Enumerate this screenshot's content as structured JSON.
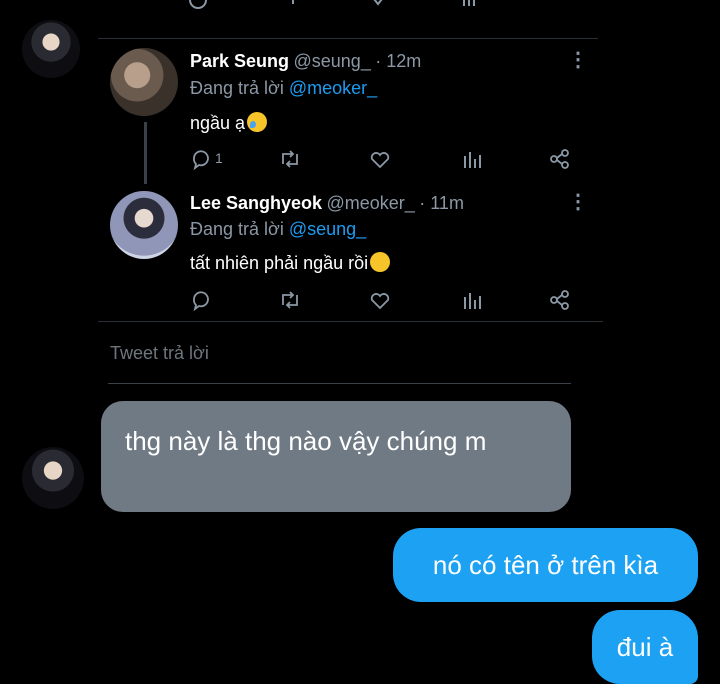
{
  "quoted_thread": {
    "tweets": [
      {
        "display_name": "Park Seung",
        "handle": "@seung_",
        "time": "· 12m",
        "reply_prefix": "Đang trả lời ",
        "reply_to": "@meoker_",
        "text": "ngầu ạ",
        "emoji": "weary-sweat-emoji",
        "reply_count": "1"
      },
      {
        "display_name": "Lee Sanghyeok",
        "handle": "@meoker_",
        "time": "· 11m",
        "reply_prefix": "Đang trả lời ",
        "reply_to": "@seung_",
        "text": "tất nhiên phải ngầu rồi",
        "emoji": "smirk-emoji"
      }
    ],
    "reply_placeholder": "Tweet trả lời"
  },
  "messages": [
    {
      "direction": "incoming",
      "text": "thg này là thg nào vậy chúng m"
    },
    {
      "direction": "outgoing",
      "text": "nó có tên ở trên kìa"
    },
    {
      "direction": "outgoing",
      "text": "đui à"
    }
  ],
  "colors": {
    "background": "#000000",
    "incoming_bubble": "#707a84",
    "outgoing_bubble": "#1da1f2",
    "link": "#1d9bf0",
    "muted_text": "#8b98a5"
  }
}
